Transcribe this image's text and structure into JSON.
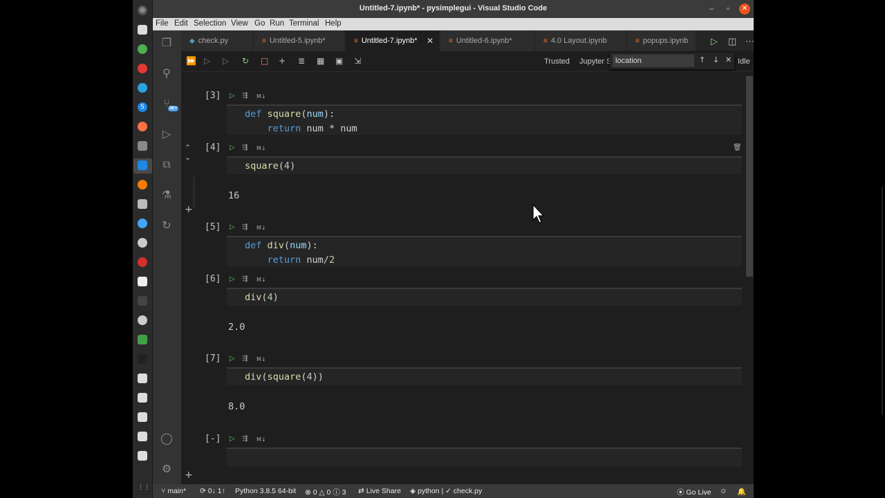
{
  "window": {
    "title": "Untitled-7.ipynb* - pysimplegui - Visual Studio Code"
  },
  "menu": [
    "File",
    "Edit",
    "Selection",
    "View",
    "Go",
    "Run",
    "Terminal",
    "Help"
  ],
  "tabs": [
    {
      "label": "check.py",
      "active": false
    },
    {
      "label": "Untitled-5.ipynb*",
      "active": false
    },
    {
      "label": "Untitled-7.ipynb*",
      "active": true
    },
    {
      "label": "Untitled-6.ipynb*",
      "active": false
    },
    {
      "label": "4.0 Layout.ipynb",
      "active": false
    },
    {
      "label": "popups.ipynb",
      "active": false
    }
  ],
  "toolbar": {
    "trusted": "Trusted",
    "kernel": "Jupyter S",
    "idle": "Idle"
  },
  "find": {
    "value": "location"
  },
  "activity": {
    "badge": "3K+"
  },
  "cells": [
    {
      "count": "[3]",
      "lines": [
        "def square(num):",
        "    return num * num"
      ],
      "output": ""
    },
    {
      "count": "[4]",
      "lines": [
        "square(4)"
      ],
      "output": "16"
    },
    {
      "count": "[5]",
      "lines": [
        "def div(num):",
        "    return num/2"
      ],
      "output": ""
    },
    {
      "count": "[6]",
      "lines": [
        "div(4)"
      ],
      "output": "2.0"
    },
    {
      "count": "[7]",
      "lines": [
        "div(square(4))"
      ],
      "output": "8.0"
    },
    {
      "count": "[-]",
      "lines": [
        ""
      ],
      "output": ""
    }
  ],
  "cell_md_label": "M↓",
  "statusbar": {
    "branch": "main*",
    "sync": "0↓ 1↑",
    "python": "Python 3.8.5 64-bit",
    "errors": "0",
    "warnings": "0",
    "info": "3",
    "liveshare": "Live Share",
    "context": "python | ✓ check.py",
    "golive": "Go Live"
  }
}
